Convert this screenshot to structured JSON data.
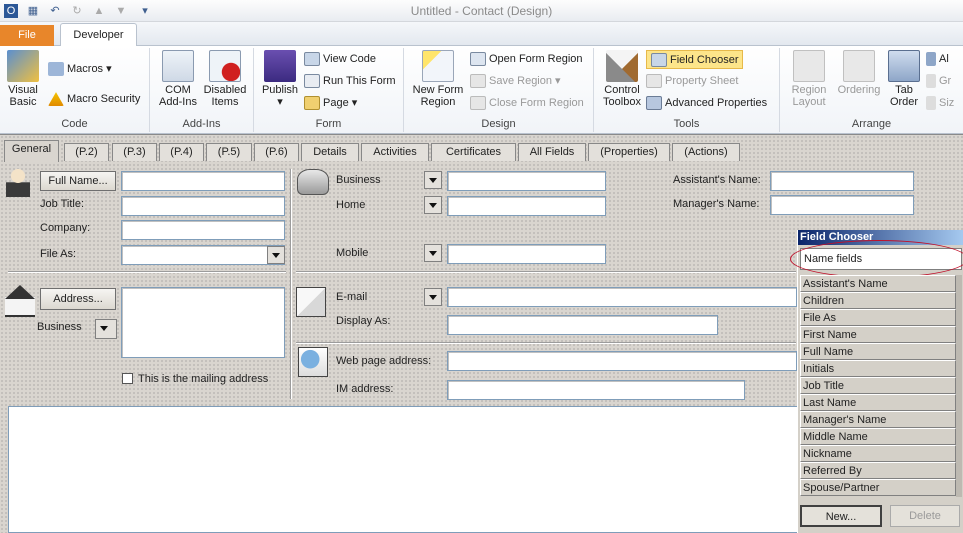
{
  "window": {
    "title": "Untitled  -  Contact   (Design)"
  },
  "quick_access": [
    "outlook-icon",
    "save-icon",
    "undo-icon",
    "redo-icon",
    "up-icon",
    "down-icon",
    "customize-icon"
  ],
  "ribbon_tabs": {
    "file": "File",
    "developer": "Developer"
  },
  "groups": {
    "code": {
      "label": "Code",
      "visual_basic": "Visual Basic",
      "macros": "Macros",
      "macro_security": "Macro Security"
    },
    "addins": {
      "label": "Add-Ins",
      "com_addins": "COM Add-Ins",
      "disabled_items": "Disabled Items"
    },
    "form": {
      "label": "Form",
      "publish": "Publish",
      "view_code": "View Code",
      "run_this_form": "Run This Form",
      "page": "Page"
    },
    "design": {
      "label": "Design",
      "new_form_region": "New Form Region",
      "open_form_region": "Open Form Region",
      "save_region": "Save Region",
      "close_form_region": "Close Form Region"
    },
    "tools": {
      "label": "Tools",
      "control_toolbox": "Control Toolbox",
      "field_chooser": "Field Chooser",
      "property_sheet": "Property Sheet",
      "advanced_properties": "Advanced Properties"
    },
    "arrange": {
      "label": "Arrange",
      "region_layout": "Region Layout",
      "ordering": "Ordering",
      "tab_order": "Tab Order",
      "cut1": "Al",
      "cut2": "Gr",
      "cut3": "Siz"
    }
  },
  "form_tabs": [
    "General",
    "(P.2)",
    "(P.3)",
    "(P.4)",
    "(P.5)",
    "(P.6)",
    "Details",
    "Activities",
    "Certificates",
    "All Fields",
    "(Properties)",
    "(Actions)"
  ],
  "form": {
    "full_name_btn": "Full Name...",
    "job_title": "Job Title:",
    "company": "Company:",
    "file_as": "File As:",
    "phone_business": "Business",
    "phone_home": "Home",
    "phone_mobile": "Mobile",
    "assistants_name": "Assistant's Name:",
    "managers_name": "Manager's Name:",
    "address_btn": "Address...",
    "address_type": "Business",
    "mailing_checkbox": "This is the mailing address",
    "email": "E-mail",
    "display_as": "Display As:",
    "web_page": "Web page address:",
    "im_address": "IM address:"
  },
  "field_chooser": {
    "title": "Field Chooser",
    "selected": "Name fields",
    "items": [
      "Assistant's Name",
      "Children",
      "File As",
      "First Name",
      "Full Name",
      "Initials",
      "Job Title",
      "Last Name",
      "Manager's Name",
      "Middle Name",
      "Nickname",
      "Referred By",
      "Spouse/Partner"
    ],
    "new_button": "New...",
    "delete_button": "Delete"
  },
  "colors": {
    "file_tab": "#e8862a",
    "field_chooser_title": "#0a246a",
    "oval": "#c0102a",
    "highlight": "#fde58a"
  }
}
